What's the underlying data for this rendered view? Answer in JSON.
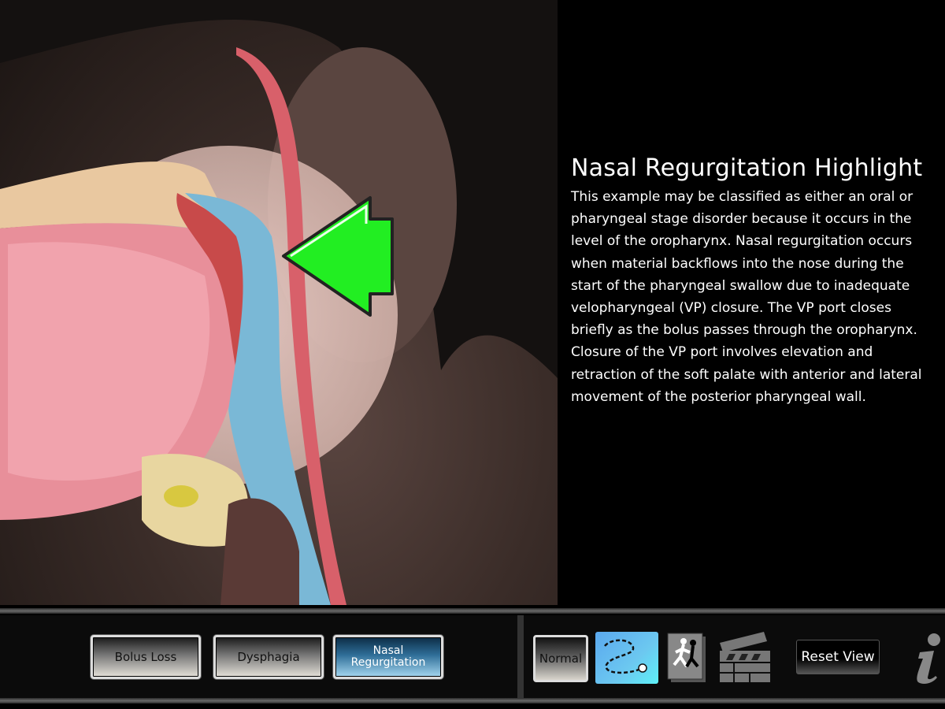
{
  "info_panel": {
    "title": "Nasal Regurgitation Highlight",
    "body": "This example may be classified as either an oral or pharyngeal stage disorder because it occurs in the level of the oropharynx. Nasal regurgitation occurs when material backflows into the nose during the start of the pharyngeal swallow due to inadequate velopharyngeal (VP) closure. The VP port closes briefly as the bolus passes through the oropharynx. Closure of the VP port involves elevation and retraction of the soft palate with anterior and lateral movement of the posterior pharyngeal wall."
  },
  "scenarios": [
    {
      "label": "Bolus Loss",
      "active": false
    },
    {
      "label": "Dysphagia",
      "active": false
    },
    {
      "label": "Nasal Regurgitation",
      "active": true
    }
  ],
  "tools": {
    "normal_label": "Normal",
    "reset_label": "Reset View"
  },
  "colors": {
    "highlight_arrow": "#22ee22",
    "active_button": "#2f6e98",
    "path_button": "#5ab8f0"
  }
}
